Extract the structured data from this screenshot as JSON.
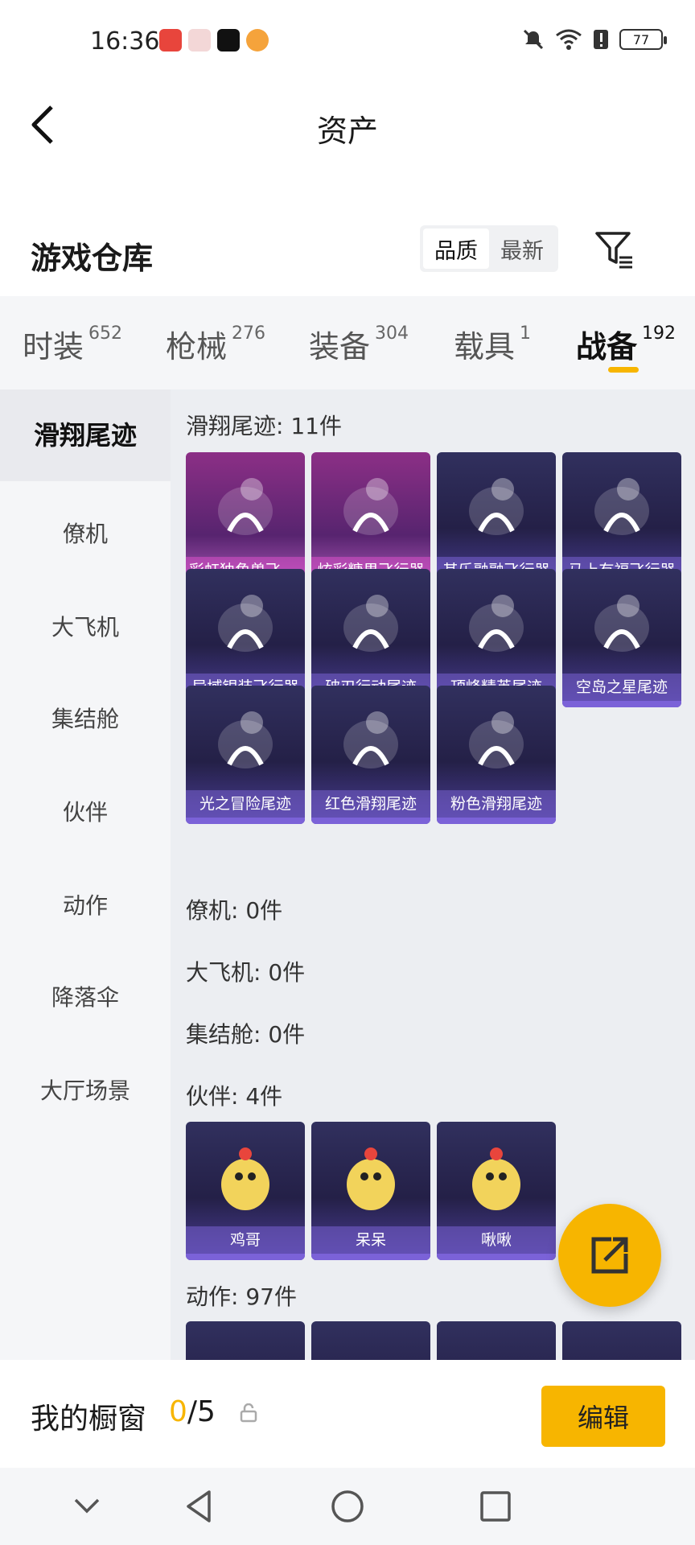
{
  "status": {
    "time": "16:36",
    "battery": "77"
  },
  "header": {
    "title": "资产"
  },
  "warehouse": {
    "title": "游戏仓库",
    "sort_options": [
      "品质",
      "最新"
    ],
    "sort_active": "品质"
  },
  "tabs": [
    {
      "label": "时装",
      "count": "652"
    },
    {
      "label": "枪械",
      "count": "276"
    },
    {
      "label": "装备",
      "count": "304"
    },
    {
      "label": "载具",
      "count": "1"
    },
    {
      "label": "战备",
      "count": "192",
      "active": true
    }
  ],
  "sidebar": {
    "items": [
      "滑翔尾迹",
      "僚机",
      "大飞机",
      "集结舱",
      "伙伴",
      "动作",
      "降落伞",
      "大厅场景"
    ],
    "active": "滑翔尾迹"
  },
  "sections": {
    "trail": {
      "label": "滑翔尾迹: 11件"
    },
    "wingman": {
      "label": "僚机: 0件"
    },
    "plane": {
      "label": "大飞机: 0件"
    },
    "pod": {
      "label": "集结舱: 0件"
    },
    "partner": {
      "label": "伙伴: 4件"
    },
    "emote": {
      "label": "动作: 97件"
    }
  },
  "trail_items": [
    {
      "name": "彩虹独角兽飞行器",
      "tier": "pink"
    },
    {
      "name": "炫彩糖果飞行器",
      "tier": "pink"
    },
    {
      "name": "其乐融融飞行器",
      "tier": "purple"
    },
    {
      "name": "马上有福飞行器",
      "tier": "purple"
    },
    {
      "name": "异域银装飞行器",
      "tier": "purple"
    },
    {
      "name": "破刃行动尾迹",
      "tier": "purple"
    },
    {
      "name": "顶峰精英尾迹",
      "tier": "purple"
    },
    {
      "name": "空岛之星尾迹",
      "tier": "purple"
    },
    {
      "name": "光之冒险尾迹",
      "tier": "purple"
    },
    {
      "name": "红色滑翔尾迹",
      "tier": "purple"
    },
    {
      "name": "粉色滑翔尾迹",
      "tier": "purple"
    }
  ],
  "partner_items": [
    {
      "name": "鸡哥"
    },
    {
      "name": "呆呆"
    },
    {
      "name": "啾啾"
    }
  ],
  "showcase": {
    "title": "我的橱窗",
    "current": "0",
    "total": "/5",
    "edit_label": "编辑"
  },
  "colors": {
    "accent": "#f7b500",
    "card_purple": "#4b3e97",
    "card_pink": "#b35cbd"
  }
}
